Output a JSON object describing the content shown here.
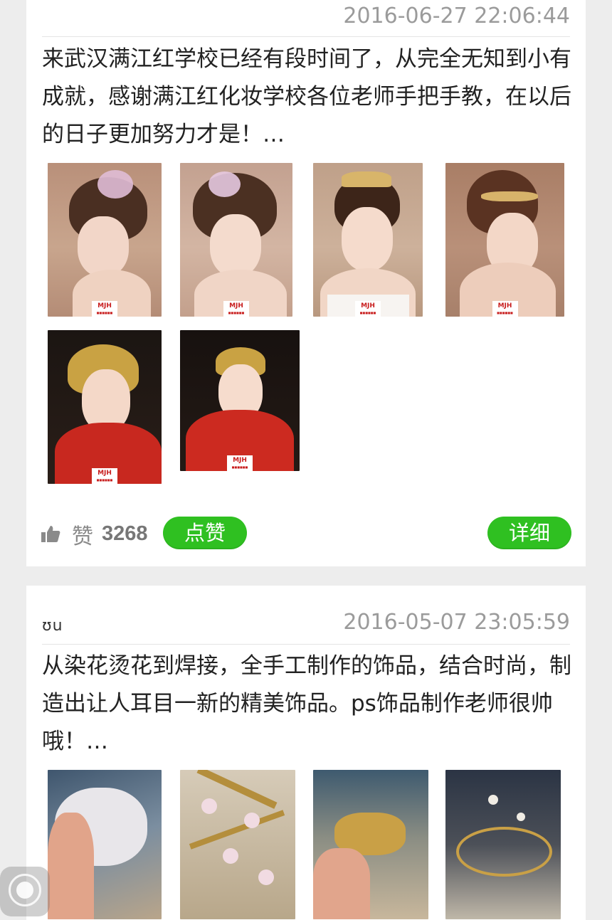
{
  "posts": [
    {
      "author": "    ",
      "timestamp": "2016-06-27 22:06:44",
      "text": "来武汉满江红学校已经有段时间了，从完全无知到小有成就，感谢满江红化妆学校各位老师手把手教，在以后的日子更加努力才是！…",
      "images": [
        {
          "desc": "bridal-updo-with-pink-flower-side",
          "watermark": "MJH"
        },
        {
          "desc": "bridal-updo-with-pink-flower-three-quarter",
          "watermark": "MJH"
        },
        {
          "desc": "bridal-updo-with-gold-tiara-front",
          "watermark": "MJH"
        },
        {
          "desc": "bridal-updo-with-gold-tiara-side",
          "watermark": "MJH"
        },
        {
          "desc": "traditional-red-qipao-gold-headdress-side",
          "watermark": "MJH"
        },
        {
          "desc": "traditional-red-qipao-gold-headdress-front",
          "watermark": "MJH"
        }
      ],
      "like_label": "赞",
      "like_count": "3268",
      "like_button": "点赞",
      "detail_button": "详细"
    },
    {
      "author": "ʊu",
      "timestamp": "2016-05-07 23:05:59",
      "text": "从染花烫花到焊接，全手工制作的饰品，结合时尚，制造出让人耳目一新的精美饰品。ps饰品制作老师很帅哦！…",
      "images": [
        {
          "desc": "handmade-white-flower-hairpiece-in-hand"
        },
        {
          "desc": "pink-blossom-gold-branch-accessory"
        },
        {
          "desc": "gold-leaf-pearl-hairpiece-in-hand"
        },
        {
          "desc": "gold-pearl-crown-on-table"
        }
      ]
    }
  ],
  "colors": {
    "accent_green": "#2fc021",
    "timestamp_gray": "#9b9b9b",
    "background": "#ededed"
  },
  "icons": {
    "thumbs_up": "thumbs-up-icon",
    "floating": "assistive-touch-icon"
  }
}
